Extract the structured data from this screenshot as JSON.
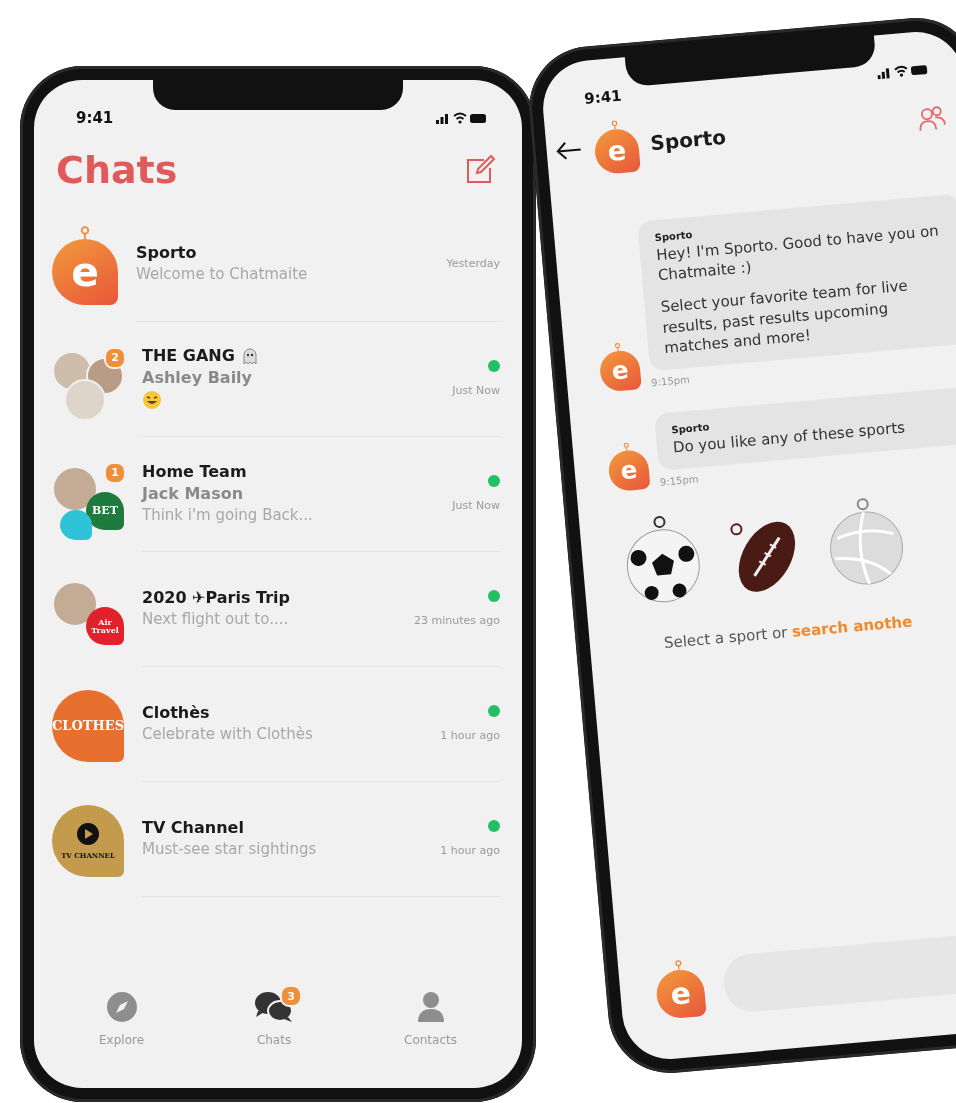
{
  "chat_list_phone": {
    "status_bar": {
      "time": "9:41"
    },
    "title": "Chats",
    "chats": [
      {
        "title": "Sporto",
        "preview": "Welcome to Chatmaite",
        "time": "Yesterday",
        "online": false,
        "avatar": {
          "kind": "logo",
          "letter": "e"
        }
      },
      {
        "title": "THE GANG",
        "title_sticker": true,
        "sender": "Ashley Baily",
        "preview_sticker": true,
        "time": "Just Now",
        "online": true,
        "avatar": {
          "kind": "photos",
          "badge": "2"
        }
      },
      {
        "title": "Home Team",
        "sender": "Jack Mason",
        "preview": "Think i'm going Back...",
        "time": "Just Now",
        "online": true,
        "avatar": {
          "kind": "photo_brands",
          "badge": "1",
          "brands": [
            {
              "kind": "text",
              "label": "BET",
              "color": "#1f7a3d"
            },
            {
              "kind": "mascot",
              "color": "#2ec3d6"
            }
          ]
        }
      },
      {
        "title": "2020 ✈Paris Trip",
        "preview": "Next flight out to....",
        "time": "23 minutes ago",
        "online": true,
        "avatar": {
          "kind": "photo_brands",
          "brands": [
            {
              "kind": "text",
              "label": "Air Travel",
              "color": "#e0222c"
            }
          ]
        }
      },
      {
        "title": "Clothès",
        "preview": "Celebrate with Clothès",
        "time": "1 hour ago",
        "online": true,
        "avatar": {
          "kind": "brand",
          "label": "CLOTHES",
          "color": "#e8702f"
        }
      },
      {
        "title": "TV Channel",
        "preview": "Must-see star sightings",
        "time": "1 hour ago",
        "online": true,
        "avatar": {
          "kind": "brand",
          "label": "TV CHANNEL",
          "play": true,
          "color": "#c49a4c"
        }
      }
    ],
    "nav": [
      {
        "label": "Explore",
        "selected": false
      },
      {
        "label": "Chats",
        "badge": "3",
        "selected": true
      },
      {
        "label": "Contacts",
        "selected": false
      }
    ]
  },
  "conversation_phone": {
    "status_bar": {
      "time": "9:41"
    },
    "header": {
      "title": "Sporto",
      "logo_letter": "e"
    },
    "messages": [
      {
        "sender": "Sporto",
        "paragraphs": [
          "Hey! I'm Sporto. Good to have you on Chatmaite :)",
          "Select your favorite team for live results, past results upcoming matches and more!"
        ],
        "time": "9:15pm",
        "logo_letter": "e"
      },
      {
        "sender": "Sporto",
        "paragraphs": [
          "Do you like any of these sports"
        ],
        "time": "9:15pm",
        "logo_letter": "e"
      }
    ],
    "sports": [
      {
        "kind": "soccer"
      },
      {
        "kind": "football"
      },
      {
        "kind": "volleyball"
      }
    ],
    "prompt": {
      "text": "Select a sport or",
      "link": "search anothe"
    },
    "composer": {
      "logo_letter": "e"
    }
  }
}
